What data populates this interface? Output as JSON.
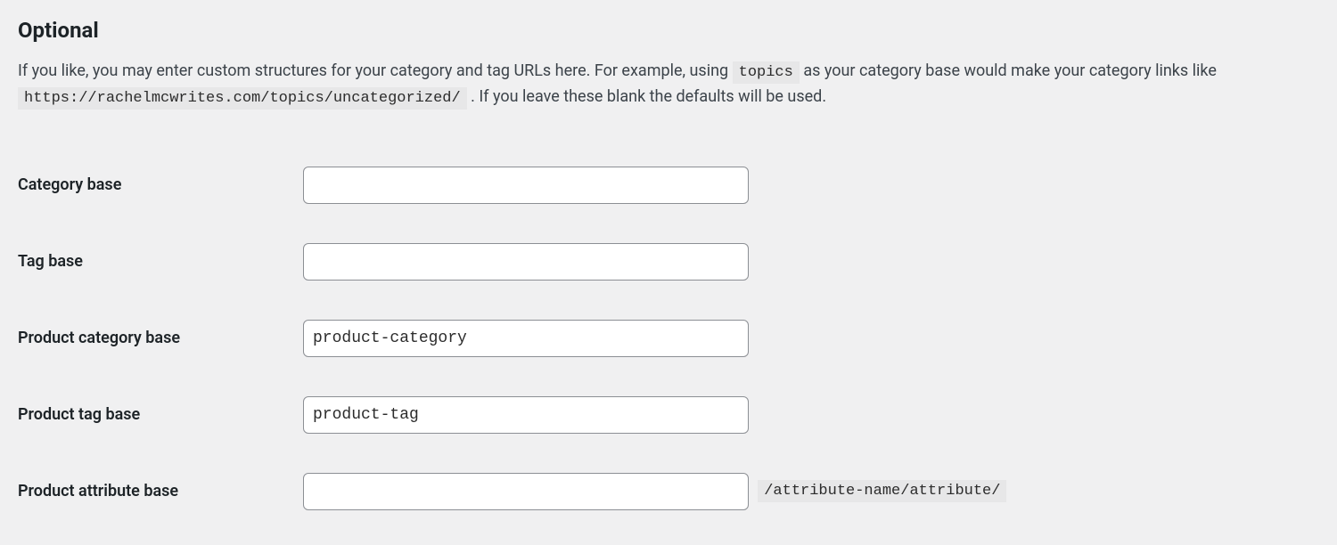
{
  "section": {
    "title": "Optional",
    "description_prefix": "If you like, you may enter custom structures for your category and tag URLs here. For example, using ",
    "description_code1": "topics",
    "description_mid": " as your category base would make your category links like ",
    "description_code2": "https://rachelmcwrites.com/topics/uncategorized/",
    "description_suffix": " . If you leave these blank the defaults will be used."
  },
  "fields": {
    "category_base": {
      "label": "Category base",
      "value": ""
    },
    "tag_base": {
      "label": "Tag base",
      "value": ""
    },
    "product_category_base": {
      "label": "Product category base",
      "value": "product-category"
    },
    "product_tag_base": {
      "label": "Product tag base",
      "value": "product-tag"
    },
    "product_attribute_base": {
      "label": "Product attribute base",
      "value": "",
      "suffix": "/attribute-name/attribute/"
    }
  }
}
